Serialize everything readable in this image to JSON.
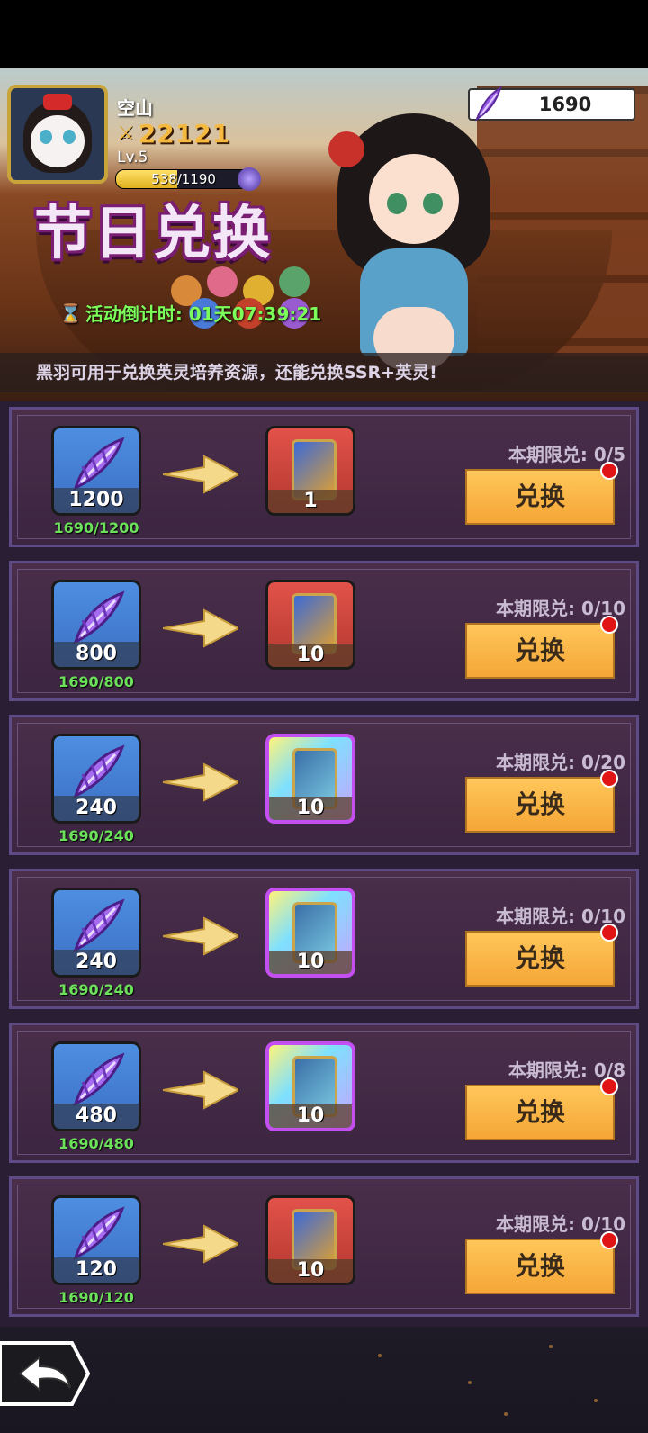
{
  "player": {
    "name": "空山",
    "power": "22121",
    "level": "Lv.5",
    "xp": "538/1190",
    "xp_fraction": 0.452
  },
  "currency": {
    "amount": "1690",
    "icon": "purple-feather-icon"
  },
  "event": {
    "title": "节日兑换",
    "countdown": "活动倒计时: 01天07:39:21",
    "description": "黑羽可用于兑换英灵培养资源，还能兑换SSR+英灵!"
  },
  "exchange_items": [
    {
      "cost": "1200",
      "have": "1690/1200",
      "reward_qty": "1",
      "reward_icon": "hero-card-icon",
      "limit": "本期限兑: 0/5",
      "button": "兑换",
      "style": "red"
    },
    {
      "cost": "800",
      "have": "1690/800",
      "reward_qty": "10",
      "reward_icon": "mystery-card-icon",
      "limit": "本期限兑: 0/10",
      "button": "兑换",
      "style": "red"
    },
    {
      "cost": "240",
      "have": "1690/240",
      "reward_qty": "10",
      "reward_icon": "rose-card-icon",
      "limit": "本期限兑: 0/20",
      "button": "兑换",
      "style": "rainbow"
    },
    {
      "cost": "240",
      "have": "1690/240",
      "reward_qty": "10",
      "reward_icon": "blue-ticket-icon",
      "limit": "本期限兑: 0/10",
      "button": "兑换",
      "style": "rainbow"
    },
    {
      "cost": "480",
      "have": "1690/480",
      "reward_qty": "10",
      "reward_icon": "purple-ticket-icon",
      "limit": "本期限兑: 0/8",
      "button": "兑换",
      "style": "rainbow"
    },
    {
      "cost": "120",
      "have": "1690/120",
      "reward_qty": "10",
      "reward_icon": "rainbow-orb-icon",
      "limit": "本期限兑: 0/10",
      "button": "兑换",
      "style": "red"
    }
  ],
  "colors": {
    "button": "#f5a636",
    "have_text": "#6ce25a",
    "countdown": "#7cff5a"
  }
}
